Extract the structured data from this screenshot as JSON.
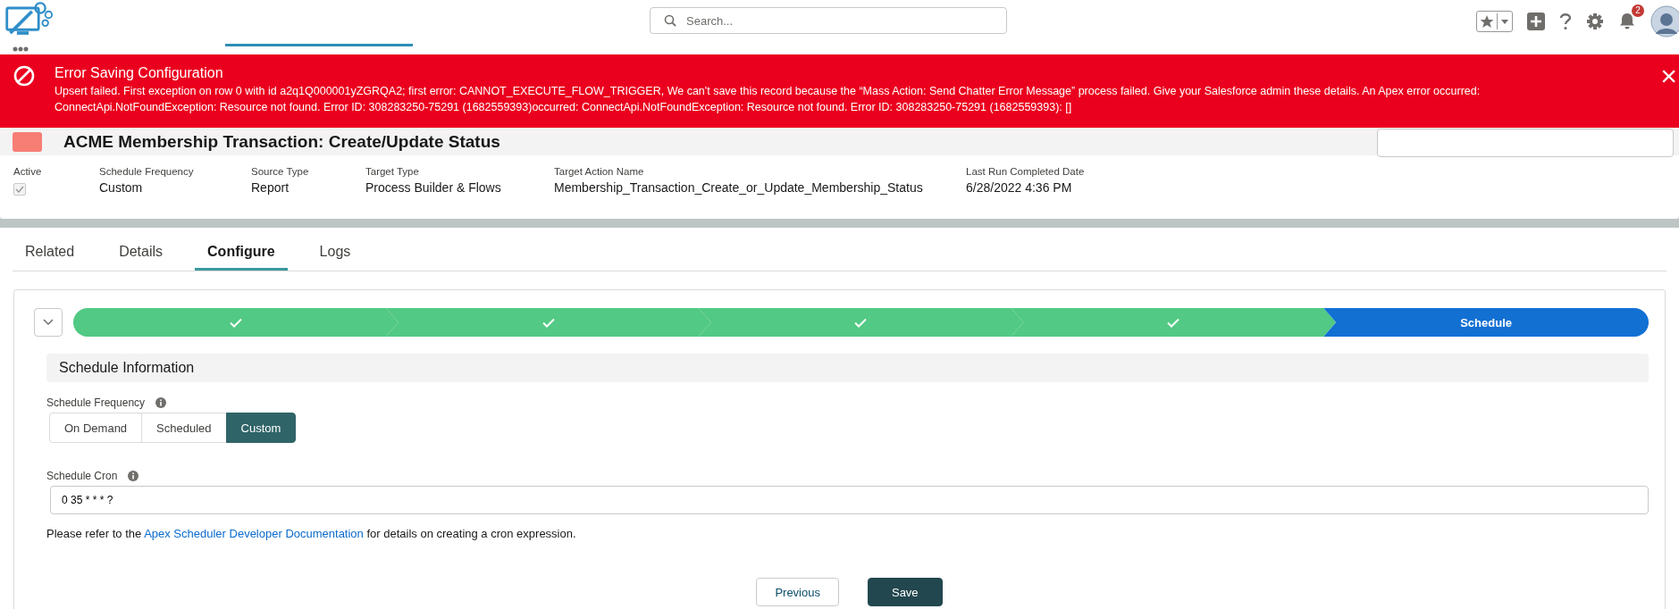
{
  "global_header": {
    "search": {
      "placeholder": "Search..."
    },
    "notifications": {
      "count": "2"
    }
  },
  "error_toast": {
    "title": "Error Saving Configuration",
    "message": "Upsert failed. First exception on row 0 with id a2q1Q000001yZGRQA2; first error: CANNOT_EXECUTE_FLOW_TRIGGER, We can't save this record because the “Mass Action: Send Chatter Error Message” process failed. Give your Salesforce admin these details. An Apex error occurred: ConnectApi.NotFoundException: Resource not found. Error ID: 308283250-75291 (1682559393)occurred: ConnectApi.NotFoundException: Resource not found. Error ID: 308283250-75291 (1682559393): []",
    "close": "×"
  },
  "record": {
    "title": "ACME Membership Transaction: Create/Update Status",
    "highlights": [
      {
        "kind": "checkbox",
        "label": "Active",
        "checked": true
      },
      {
        "kind": "text",
        "label": "Schedule Frequency",
        "value": "Custom"
      },
      {
        "kind": "text",
        "label": "Source Type",
        "value": "Report"
      },
      {
        "kind": "text",
        "label": "Target Type",
        "value": "Process Builder & Flows"
      },
      {
        "kind": "text",
        "label": "Target Action Name",
        "value": "Membership_Transaction_Create_or_Update_Membership_Status"
      },
      {
        "kind": "text",
        "label": "Last Run Completed Date",
        "value": "6/28/2022 4:36 PM"
      }
    ]
  },
  "tabs": [
    {
      "label": "Related",
      "selected": false
    },
    {
      "label": "Details",
      "selected": false
    },
    {
      "label": "Configure",
      "selected": true
    },
    {
      "label": "Logs",
      "selected": false
    }
  ],
  "path": {
    "stages": [
      {
        "kind": "complete",
        "selected": false
      },
      {
        "kind": "complete",
        "selected": false
      },
      {
        "kind": "complete",
        "selected": false
      },
      {
        "kind": "complete",
        "selected": false
      },
      {
        "kind": "current",
        "label": "Schedule",
        "selected": true
      }
    ]
  },
  "section": {
    "title": "Schedule Information",
    "frequency": {
      "label": "Schedule Frequency",
      "options": [
        {
          "label": "On Demand",
          "selected": false
        },
        {
          "label": "Scheduled",
          "selected": false
        },
        {
          "label": "Custom",
          "selected": true
        }
      ]
    },
    "cron": {
      "label": "Schedule Cron",
      "value": "0 35 * * * ?"
    },
    "help": {
      "before": "Please refer to the",
      "link": "Apex Scheduler Developer Documentation",
      "after": "for details on creating a cron expression."
    }
  },
  "buttons": [
    {
      "label": "Previous",
      "kind": "neutral"
    },
    {
      "label": "Save",
      "kind": "brand"
    }
  ]
}
